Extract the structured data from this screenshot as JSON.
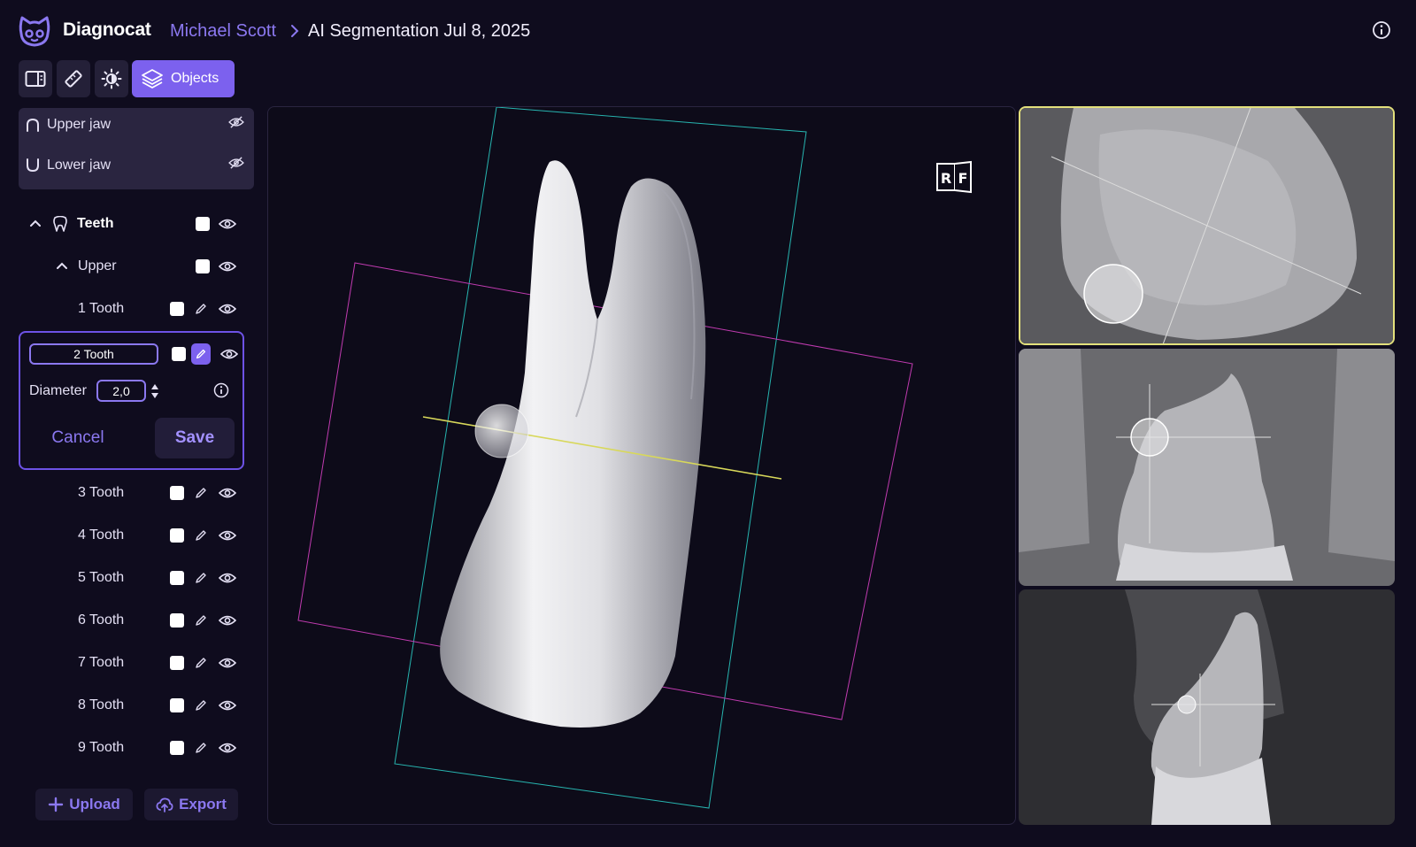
{
  "header": {
    "brand": "Diagnocat",
    "breadcrumb_user": "Michael Scott",
    "breadcrumb_page": "AI Segmentation Jul 8, 2025"
  },
  "toolbar": {
    "objects_label": "Objects",
    "accent": "#7c61ee"
  },
  "jaws": [
    {
      "label": "Upper jaw",
      "icon": "upper-jaw-icon",
      "visible": false
    },
    {
      "label": "Lower jaw",
      "icon": "lower-jaw-icon",
      "visible": false
    }
  ],
  "tree": {
    "teeth_label": "Teeth",
    "upper_label": "Upper",
    "items": [
      {
        "label": "1 Tooth"
      },
      {
        "label": "2 Tooth",
        "editing": true
      },
      {
        "label": "3 Tooth"
      },
      {
        "label": "4 Tooth"
      },
      {
        "label": "5 Tooth"
      },
      {
        "label": "6 Tooth"
      },
      {
        "label": "7 Tooth"
      },
      {
        "label": "8 Tooth"
      },
      {
        "label": "9 Tooth"
      }
    ]
  },
  "edit": {
    "name_value": "2 Tooth",
    "diameter_label": "Diameter",
    "diameter_value": "2,0",
    "cancel_label": "Cancel",
    "save_label": "Save"
  },
  "actions": {
    "upload_label": "Upload",
    "export_label": "Export"
  },
  "viewer": {
    "orientation_marker": [
      "R",
      "F"
    ],
    "selected_slice_color": "#e3e07c"
  }
}
